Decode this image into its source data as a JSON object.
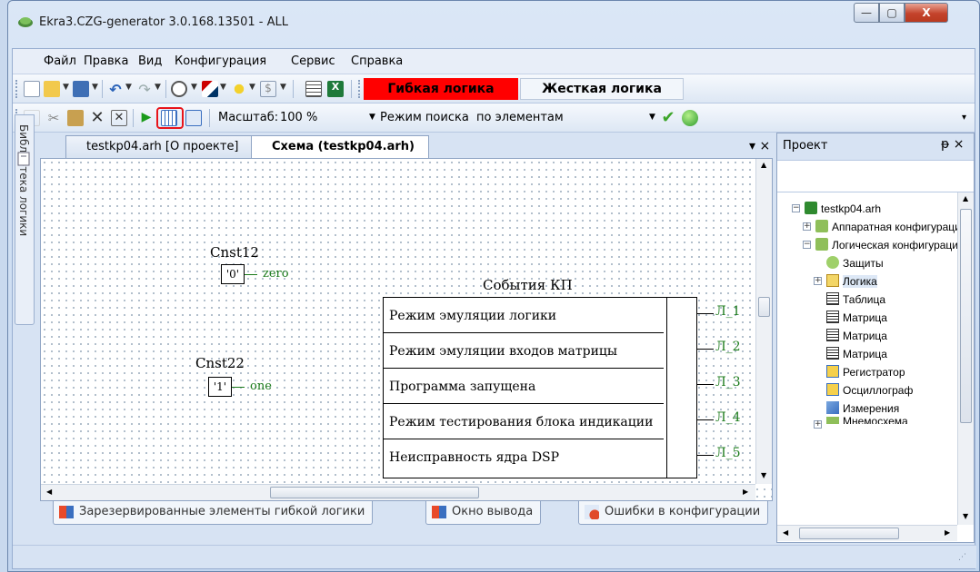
{
  "window": {
    "title": "Ekra3.CZG-generator 3.0.168.13501 - ALL",
    "minimize": "—",
    "maximize": "▢",
    "close": "X"
  },
  "menu": [
    "Файл",
    "Правка",
    "Вид",
    "Конфигурация",
    "Сервис",
    "Справка"
  ],
  "toolbar1": {
    "flex_logic": "Гибкая логика",
    "hard_logic": "Жесткая логика"
  },
  "toolbar2": {
    "scale_label": "Масштаб:",
    "scale_value": "100 %",
    "search_mode_label": "Режим поиска",
    "search_mode_value": "по элементам"
  },
  "left_tab": "Библиотека логики",
  "tabs": [
    {
      "label": "testkp04.arh [О проекте]"
    },
    {
      "label": "Схема (testkp04.arh)"
    }
  ],
  "tabs_controls": "▾ ×",
  "scheme": {
    "const1": {
      "name": "Cnst12",
      "value": "'0'",
      "output": "zero"
    },
    "const2": {
      "name": "Cnst22",
      "value": "'1'",
      "output": "one"
    },
    "events": {
      "title": "События КП",
      "rows": [
        {
          "text": "Режим эмуляции логики",
          "out": "Л_1"
        },
        {
          "text": "Режим эмуляции входов матрицы",
          "out": "Л_2"
        },
        {
          "text": "Программа запущена",
          "out": "Л_3"
        },
        {
          "text": "Режим тестирования блока индикации",
          "out": "Л_4"
        },
        {
          "text": "Неисправность ядра DSP",
          "out": "Л_5"
        }
      ]
    }
  },
  "project": {
    "title": "Проект",
    "controls": "ᵽ ×",
    "items": [
      {
        "label": "testkp04.arh",
        "icon": "project-icon"
      },
      {
        "label": "Аппаратная конфигурация",
        "icon": "folder-icon"
      },
      {
        "label": "Логическая конфигурация",
        "icon": "folder-icon"
      },
      {
        "label": "Защиты",
        "icon": "shield-icon"
      },
      {
        "label": "Логика",
        "icon": "logic-icon"
      },
      {
        "label": "Таблица",
        "icon": "table-icon"
      },
      {
        "label": "Матрица",
        "icon": "table-icon"
      },
      {
        "label": "Матрица",
        "icon": "table-icon"
      },
      {
        "label": "Матрица",
        "icon": "table-icon"
      },
      {
        "label": "Регистратор",
        "icon": "register-icon"
      },
      {
        "label": "Осциллограф",
        "icon": "register-icon"
      },
      {
        "label": "Измерения",
        "icon": "measure-icon"
      },
      {
        "label": "Мнемосхема",
        "icon": "mnemo-icon"
      }
    ]
  },
  "bottom_tabs": [
    "Зарезервированные элементы гибкой логики",
    "Окно вывода",
    "Ошибки в конфигурации"
  ],
  "colors": {
    "flex_logic_bg": "#ff0000",
    "highlight_border": "#e8141a",
    "green_wire": "#1a7a1a"
  }
}
